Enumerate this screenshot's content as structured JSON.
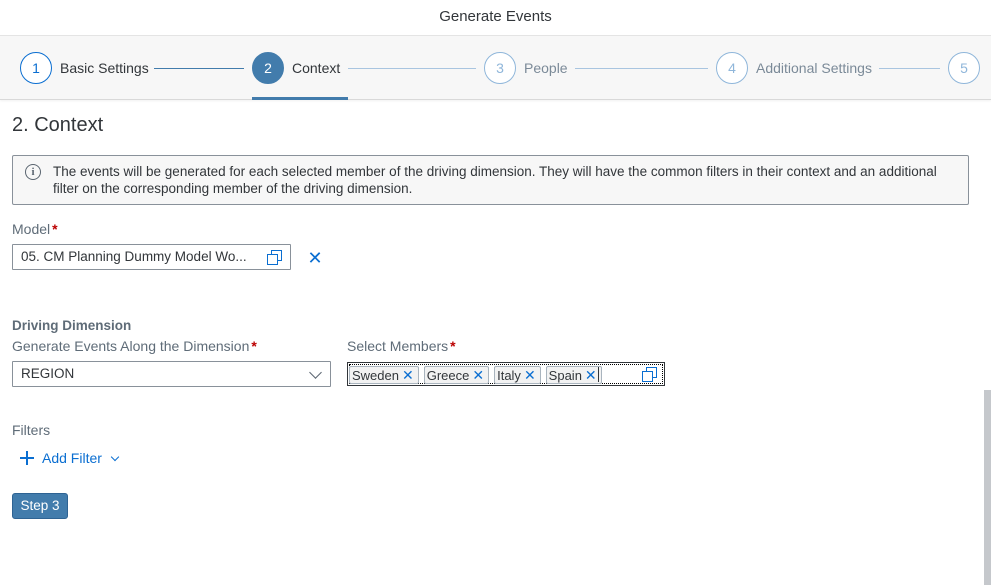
{
  "dialog": {
    "title": "Generate Events"
  },
  "wizard": {
    "steps": [
      {
        "number": "1",
        "label": "Basic Settings",
        "state": "completed"
      },
      {
        "number": "2",
        "label": "Context",
        "state": "active"
      },
      {
        "number": "3",
        "label": "People",
        "state": "disabled"
      },
      {
        "number": "4",
        "label": "Additional Settings",
        "state": "disabled"
      },
      {
        "number": "5",
        "label": "",
        "state": "disabled"
      }
    ]
  },
  "section": {
    "heading": "2. Context",
    "info_text": "The events will be generated for each selected member of the driving dimension. They will have the common filters in their context and an additional filter on the corresponding member of the driving dimension."
  },
  "model": {
    "label": "Model",
    "required_mark": "*",
    "value": "05. CM Planning Dummy Model Wo..."
  },
  "driving_dimension": {
    "title": "Driving Dimension",
    "generate_label": "Generate Events Along the Dimension",
    "required_mark": "*",
    "selected_value": "REGION",
    "members_label": "Select Members",
    "members": [
      "Sweden",
      "Greece",
      "Italy",
      "Spain"
    ]
  },
  "filters": {
    "label": "Filters",
    "add_filter_label": "Add Filter"
  },
  "footer": {
    "step_button_label": "Step 3"
  },
  "colors": {
    "accent": "#0a6ed1",
    "active_step": "#427cac",
    "required": "#bb0000"
  }
}
